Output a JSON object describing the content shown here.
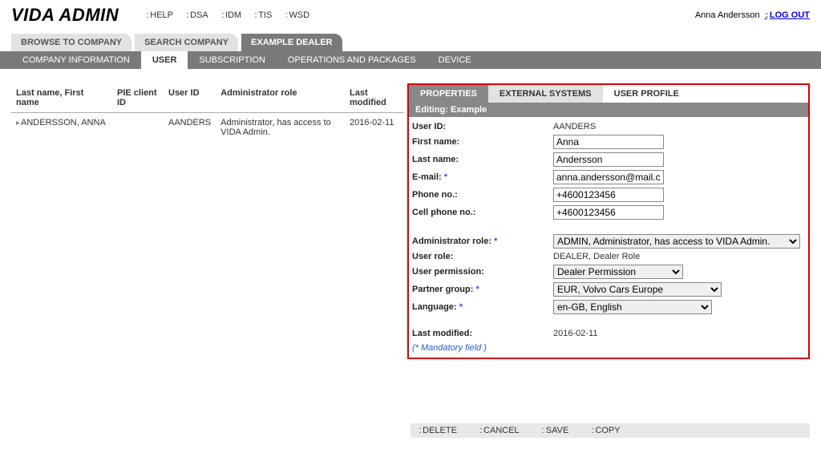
{
  "header": {
    "logo": "VIDA ADMIN",
    "links": [
      "HELP",
      "DSA",
      "IDM",
      "TIS",
      "WSD"
    ],
    "user": "Anna Andersson",
    "logout": "LOG OUT"
  },
  "tabs": {
    "browse": "BROWSE TO COMPANY",
    "search": "SEARCH COMPANY",
    "dealer": "EXAMPLE DEALER"
  },
  "subtabs": {
    "company_info": "COMPANY INFORMATION",
    "user": "USER",
    "subscription": "SUBSCRIPTION",
    "ops": "OPERATIONS AND PACKAGES",
    "device": "DEVICE"
  },
  "table": {
    "headers": {
      "name": "Last name, First name",
      "pie": "PIE client ID",
      "userid": "User ID",
      "role": "Administrator role",
      "modified": "Last modified"
    },
    "rows": [
      {
        "name": "ANDERSSON, ANNA",
        "pie": "",
        "userid": "AANDERS",
        "role": "Administrator, has access to VIDA Admin.",
        "modified": "2016-02-11"
      }
    ]
  },
  "panel": {
    "tabs": {
      "properties": "PROPERTIES",
      "external": "EXTERNAL SYSTEMS",
      "profile": "USER PROFILE"
    },
    "editing": "Editing: Example",
    "labels": {
      "userid": "User ID:",
      "first": "First name:",
      "last": "Last name:",
      "email": "E-mail:",
      "phone": "Phone no.:",
      "cell": "Cell phone no.:",
      "adminrole": "Administrator role:",
      "userrole": "User role:",
      "userperm": "User permission:",
      "partner": "Partner group:",
      "language": "Language:",
      "modified": "Last modified:"
    },
    "values": {
      "userid": "AANDERS",
      "first": "Anna",
      "last": "Andersson",
      "email": "anna.andersson@mail.co",
      "phone": "+4600123456",
      "cell": "+4600123456",
      "adminrole": "ADMIN, Administrator, has access to VIDA Admin.",
      "userrole": "DEALER, Dealer Role",
      "userperm": "Dealer Permission",
      "partner": "EUR, Volvo Cars Europe",
      "language": "en-GB, English",
      "modified": "2016-02-11"
    },
    "mandatory": "(* Mandatory field )"
  },
  "footer": {
    "delete": "DELETE",
    "cancel": "CANCEL",
    "save": "SAVE",
    "copy": "COPY"
  }
}
